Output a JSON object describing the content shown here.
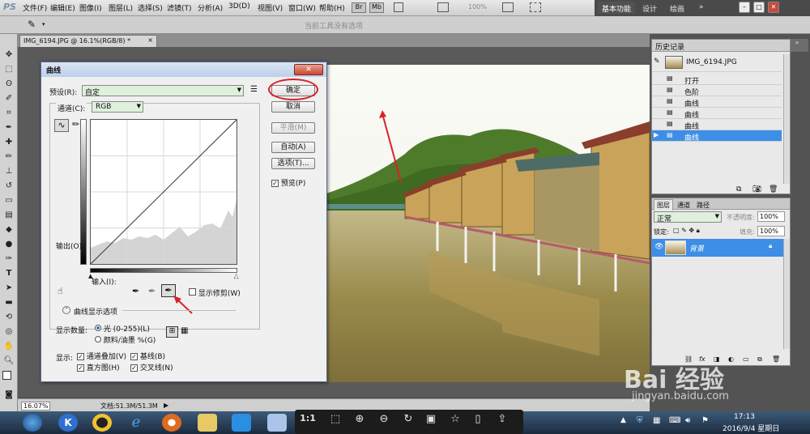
{
  "app": {
    "logo": "PS",
    "menus": [
      "文件(F)",
      "编辑(E)",
      "图像(I)",
      "图层(L)",
      "选择(S)",
      "滤镜(T)",
      "分析(A)",
      "3D(D)",
      "视图(V)",
      "窗口(W)",
      "帮助(H)"
    ],
    "zoom_menu": "100%",
    "workspaces": {
      "active": "基本功能",
      "design": "设计",
      "paint": "绘画"
    },
    "window_controls": [
      "–",
      "□",
      "✕"
    ]
  },
  "options_bar": {
    "hint": "当前工具没有选项"
  },
  "document": {
    "tab_title": "IMG_6194.JPG @ 16.1%(RGB/8) *",
    "close": "×"
  },
  "status_bar": {
    "zoom": "16.07%",
    "doc_size": "文档:51.3M/51.3M"
  },
  "curves_dialog": {
    "title": "曲线",
    "preset_label": "预设(R):",
    "preset_value": "自定",
    "channel_label": "通道(C):",
    "channel_value": "RGB",
    "output_label": "输出(O):",
    "input_label": "输入(I):",
    "show_clipping": "显示修剪(W)",
    "curve_options": "曲线显示选项",
    "show_amount_label": "显示数量:",
    "amount_light": "光 (0-255)(L)",
    "amount_pigment": "颜料/油墨 %(G)",
    "show_label": "显示:",
    "opt_overlay": "通道叠加(V)",
    "opt_baseline": "基线(B)",
    "opt_histogram": "直方图(H)",
    "opt_intersect": "交叉线(N)",
    "buttons": {
      "ok": "确定",
      "cancel": "取消",
      "smooth": "平滑(M)",
      "auto": "自动(A)",
      "options": "选项(T)...",
      "preview": "预览(P)"
    }
  },
  "history_panel": {
    "title": "历史记录",
    "snapshot": "IMG_6194.JPG",
    "steps": [
      "打开",
      "色阶",
      "曲线",
      "曲线",
      "曲线",
      "曲线"
    ],
    "active_index": 5
  },
  "layers_panel": {
    "tabs": [
      "图层",
      "通道",
      "路径"
    ],
    "blend_mode": "正常",
    "opacity_label": "不透明度:",
    "opacity_value": "100%",
    "lock_label": "锁定:",
    "fill_label": "填充:",
    "fill_value": "100%",
    "layer_name": "背景"
  },
  "taskbar": {
    "time": "17:13",
    "date": "2016/9/4 星期日"
  },
  "viewer_bar": {
    "ratio": "1:1"
  },
  "watermark": {
    "brand": "Bai 经验",
    "url": "jingyan.baidu.com"
  },
  "colors": {
    "accent_selected": "#3d8ee6",
    "annotation_red": "#d8222a",
    "dialog_title": "#bcd0ea"
  }
}
